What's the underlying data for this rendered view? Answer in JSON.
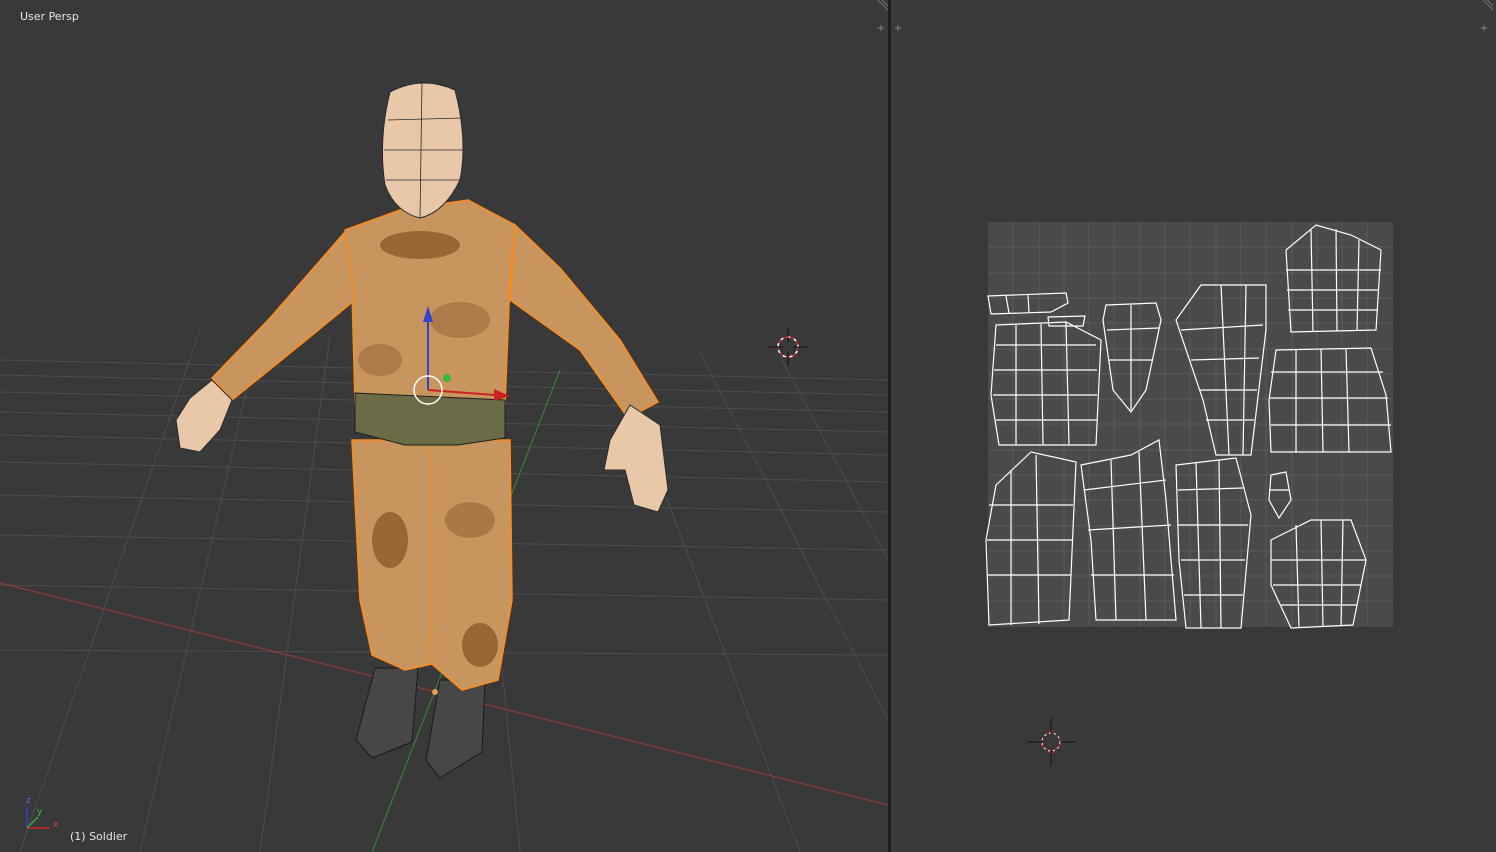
{
  "viewport": {
    "view_label": "User Persp",
    "object_label": "(1) Soldier",
    "axis_x": "x",
    "axis_y": "y",
    "axis_z": "z"
  },
  "uv_editor": {
    "grid_color": "#6a6a6a",
    "background_color": "#393939"
  },
  "colors": {
    "selection": "#ff8c1a",
    "skin": "#e8c8a8",
    "camo_base": "#c9955f",
    "camo_dark": "#8b5a2b",
    "belt": "#6b6b45",
    "boots": "#4a4a4a",
    "axis_x": "#cc3333",
    "axis_y": "#33aa33",
    "axis_z": "#3344cc"
  }
}
